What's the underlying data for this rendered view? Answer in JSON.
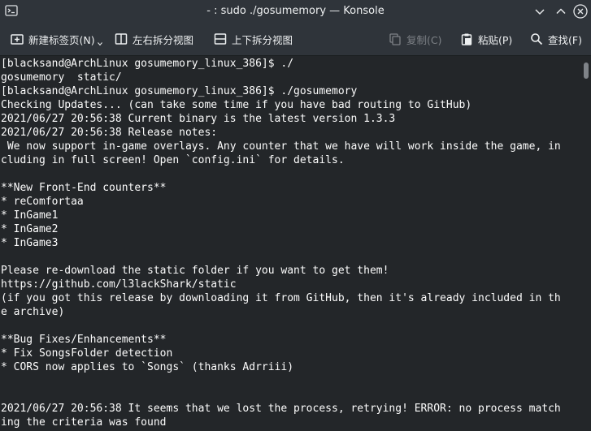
{
  "titlebar": {
    "title": "- : sudo ./gosumemory — Konsole",
    "app_icon": "terminal-icon",
    "buttons": [
      "chevron-down-icon",
      "chevron-up-icon",
      "close-icon"
    ]
  },
  "toolbar": {
    "new_tab": "新建标签页(N)",
    "split_lr": "左右拆分视图",
    "split_tb": "上下拆分视图",
    "copy": "复制(C)",
    "paste": "粘贴(P)",
    "find": "查找(F)"
  },
  "terminal": {
    "lines": [
      "[blacksand@ArchLinux gosumemory_linux_386]$ ./",
      "gosumemory  static/",
      "[blacksand@ArchLinux gosumemory_linux_386]$ ./gosumemory",
      "Checking Updates... (can take some time if you have bad routing to GitHub)",
      "2021/06/27 20:56:38 Current binary is the latest version 1.3.3",
      "2021/06/27 20:56:38 Release notes:",
      " We now support in-game overlays. Any counter that we have will work inside the game, in",
      "cluding in full screen! Open `config.ini` for details.",
      "",
      "**New Front-End counters**",
      "* reComfortaa",
      "* InGame1",
      "* InGame2",
      "* InGame3",
      "",
      "Please re-download the static folder if you want to get them!",
      "https://github.com/l3lackShark/static",
      "(if you got this release by downloading it from GitHub, then it's already included in th",
      "e archive)",
      "",
      "**Bug Fixes/Enhancements**",
      "* Fix SongsFolder detection",
      "* CORS now applies to `Songs` (thanks Adrriii)",
      "",
      "",
      "2021/06/27 20:56:38 It seems that we lost the process, retrying! ERROR: no process match",
      "ing the criteria was found"
    ]
  },
  "colors": {
    "background": "#232629",
    "chrome": "#2f343a",
    "text": "#fcfcfc",
    "disabled_text": "#7d8186"
  }
}
